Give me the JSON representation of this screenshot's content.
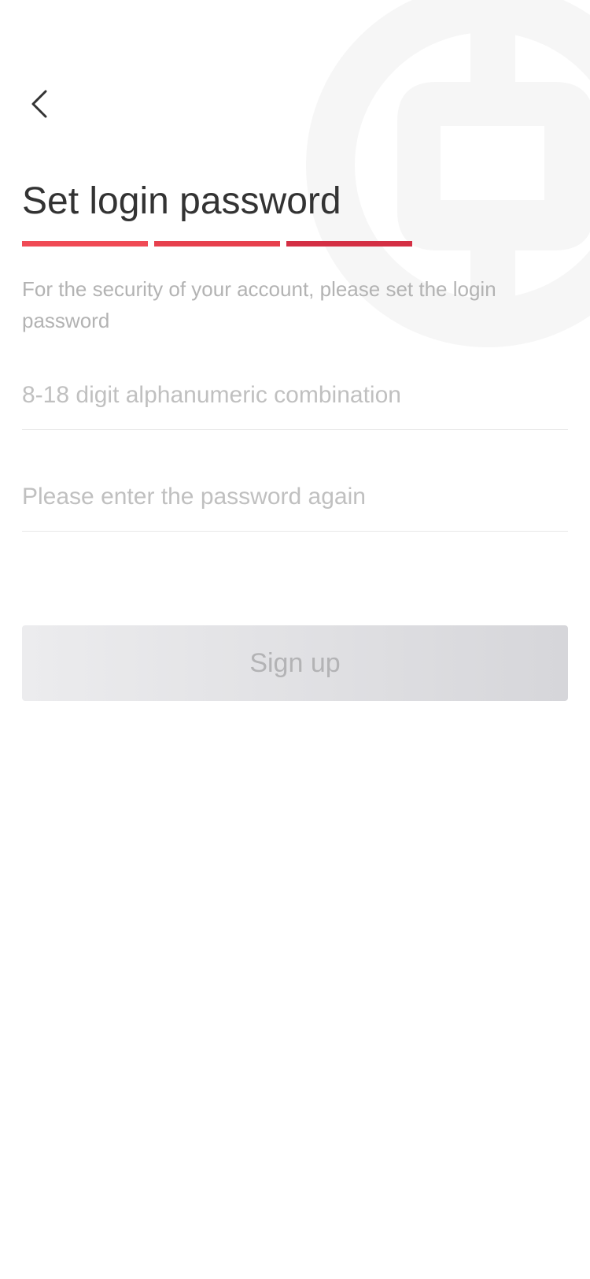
{
  "header": {
    "back_icon": "chevron-left-icon"
  },
  "main": {
    "title": "Set login password",
    "progress": {
      "steps_total": 3,
      "steps_filled": 3,
      "colors": [
        "#f04a55",
        "#e7404d",
        "#d42f44"
      ]
    },
    "subtitle": "For the security of your account, please set the login password",
    "password_field": {
      "value": "",
      "placeholder": "8-18 digit alphanumeric combination"
    },
    "confirm_field": {
      "value": "",
      "placeholder": "Please enter the password again"
    },
    "signup_label": "Sign up"
  },
  "decor": {
    "watermark_icon": "bank-logo-icon"
  },
  "colors": {
    "accent": "#e7404d",
    "title_text": "#333333",
    "hint_text": "#b3b3b3",
    "button_disabled_text": "#b3b3b5"
  }
}
